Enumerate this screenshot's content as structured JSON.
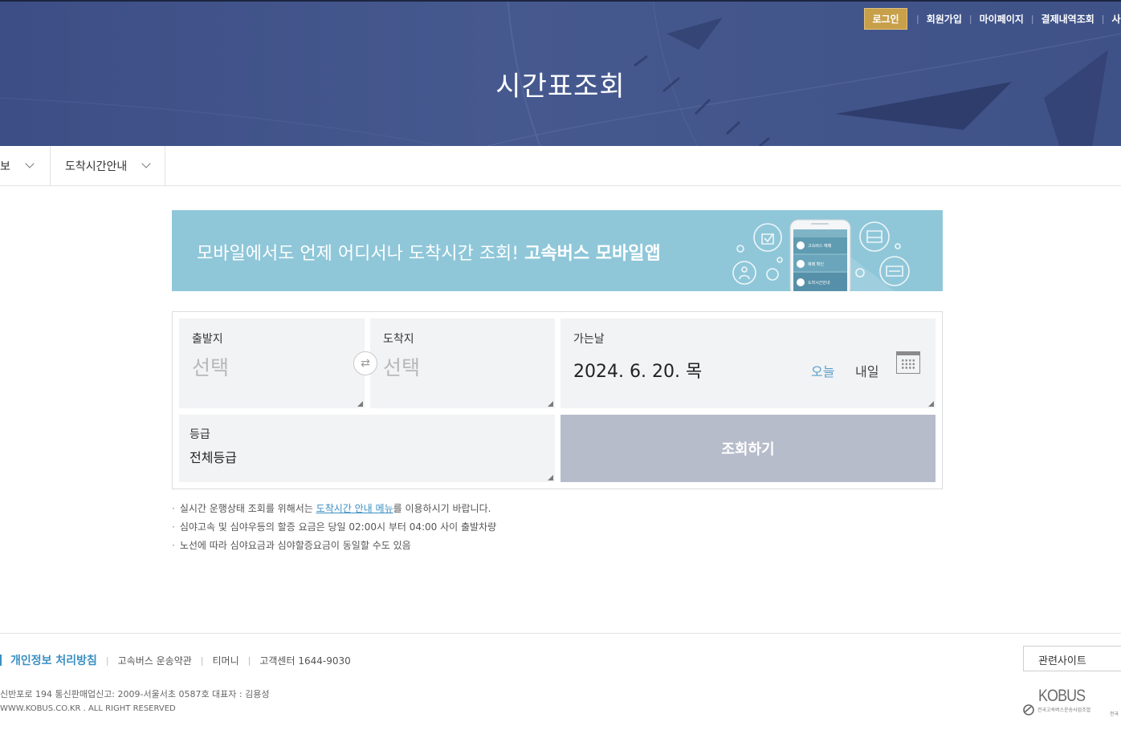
{
  "header": {
    "title": "시간표조회",
    "login_label": "로그인",
    "util_links": [
      "회원가입",
      "마이페이지",
      "결제내역조회",
      "사이트"
    ]
  },
  "subnav": {
    "items": [
      {
        "label": "보"
      },
      {
        "label": "도착시간안내"
      }
    ]
  },
  "banner": {
    "text_normal": "모바일에서도 언제 어디서나 도착시간 조회! ",
    "text_bold": "고속버스 모바일앱",
    "phone_menu": [
      "고속버스 예매",
      "예매 확인",
      "도착시간안내"
    ]
  },
  "search": {
    "departure": {
      "label": "출발지",
      "value": "선택"
    },
    "arrival": {
      "label": "도착지",
      "value": "선택"
    },
    "date": {
      "label": "가는날",
      "value": "2024. 6. 20. 목",
      "today_label": "오늘",
      "tomorrow_label": "내일"
    },
    "grade": {
      "label": "등급",
      "value": "전체등급"
    },
    "submit_label": "조회하기"
  },
  "notes": {
    "n1_before": "실시간 운행상태 조회를 위해서는 ",
    "n1_link": "도착시간 안내 메뉴",
    "n1_after": "를 이용하시기 바랍니다.",
    "n2": "심야고속 및 심야우등의 할증 요금은 당일 02:00시 부터 04:00 사이 출발차량",
    "n3": "노선에 따라 심야요금과 심야할증요금이 동일할 수도 있음"
  },
  "footer": {
    "links": [
      "개인정보 처리방침",
      "고속버스 운송약관",
      "티머니",
      "고객센터 1644-9030"
    ],
    "info_line1": "신반포로 194 통신판매업신고: 2009-서울서초 0587호 대표자 : 김용성",
    "info_line2": "WWW.KOBUS.CO.KR . ALL RIGHT RESERVED",
    "related_label": "관련사이트",
    "logo_word": "KOBUS",
    "logo_sub": "전국고속버스운송사업조합",
    "logo_side": "전국"
  },
  "colors": {
    "hero": "#46598f",
    "login": "#c8a04a",
    "banner": "#8fc7d9",
    "submit": "#b7bccb",
    "link": "#3a8fc2"
  }
}
